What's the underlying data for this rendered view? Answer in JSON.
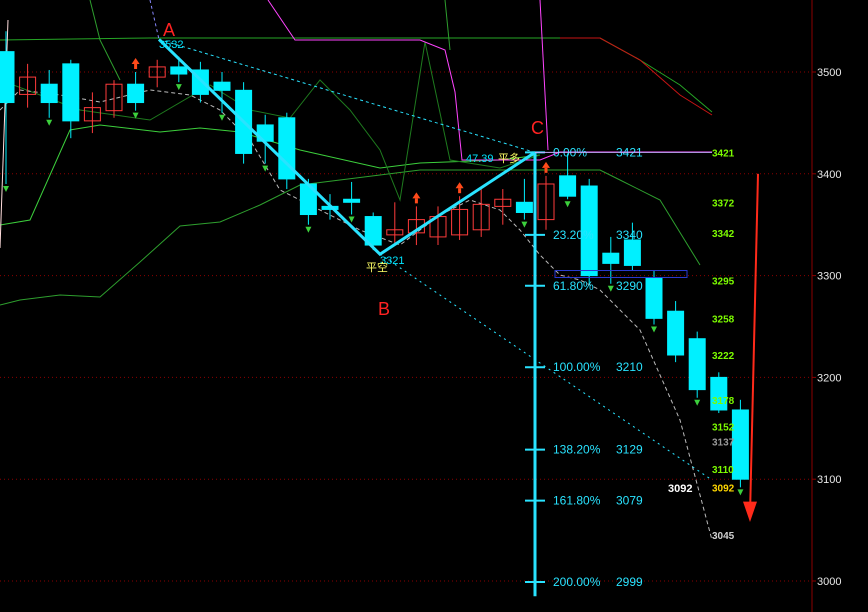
{
  "chart_data": {
    "type": "candlestick",
    "ylim": [
      2985,
      3600
    ],
    "grid": true,
    "price_axis": {
      "ticks": [
        3500,
        3400,
        3300,
        3200,
        3100,
        3000
      ]
    },
    "right_levels": [
      {
        "value": 3421,
        "color": "#7CFC00"
      },
      {
        "value": 3372,
        "color": "#7CFC00"
      },
      {
        "value": 3342,
        "color": "#7CFC00"
      },
      {
        "value": 3295,
        "color": "#7CFC00"
      },
      {
        "value": 3258,
        "color": "#7CFC00"
      },
      {
        "value": 3222,
        "color": "#7CFC00"
      },
      {
        "value": 3178,
        "color": "#7CFC00"
      },
      {
        "value": 3152,
        "color": "#7CFC00"
      },
      {
        "value": 3137,
        "color": "#9a9a9a"
      },
      {
        "value": 3110,
        "color": "#7CFC00"
      },
      {
        "value": 3092,
        "color": "#FFD700"
      },
      {
        "value": 3045,
        "color": "#d0d0d0"
      }
    ],
    "fib_levels": [
      {
        "pct": "0.00%",
        "price": "3421"
      },
      {
        "pct": "23.20%",
        "price": "3340"
      },
      {
        "pct": "61.80%",
        "price": "3290"
      },
      {
        "pct": "100.00%",
        "price": "3210"
      },
      {
        "pct": "138.20%",
        "price": "3129"
      },
      {
        "pct": "161.80%",
        "price": "3079"
      },
      {
        "pct": "200.00%",
        "price": "2999"
      }
    ],
    "fib_tick_values": [
      3421,
      3340,
      3290,
      3210,
      3129,
      3079,
      2999
    ],
    "points": [
      {
        "label": "A",
        "value": 3532,
        "value_label": "3532"
      },
      {
        "label": "B",
        "value": 3321,
        "value_label": "3321"
      },
      {
        "label": "C",
        "value": 3421,
        "value_label": ""
      }
    ],
    "annotations": {
      "ratio": "47.39",
      "b_tag": "平空",
      "c_tag": "平多",
      "low_label": "3092"
    },
    "candles": [
      {
        "o": 3520,
        "h": 3540,
        "l": 3390,
        "c": 3470
      },
      {
        "o": 3478,
        "h": 3508,
        "l": 3465,
        "c": 3495
      },
      {
        "o": 3488,
        "h": 3502,
        "l": 3455,
        "c": 3470
      },
      {
        "o": 3508,
        "h": 3512,
        "l": 3435,
        "c": 3452
      },
      {
        "o": 3452,
        "h": 3480,
        "l": 3440,
        "c": 3465
      },
      {
        "o": 3462,
        "h": 3492,
        "l": 3455,
        "c": 3488
      },
      {
        "o": 3488,
        "h": 3500,
        "l": 3462,
        "c": 3470
      },
      {
        "o": 3495,
        "h": 3512,
        "l": 3485,
        "c": 3505
      },
      {
        "o": 3505,
        "h": 3515,
        "l": 3490,
        "c": 3498
      },
      {
        "o": 3502,
        "h": 3510,
        "l": 3470,
        "c": 3478
      },
      {
        "o": 3490,
        "h": 3500,
        "l": 3460,
        "c": 3482
      },
      {
        "o": 3482,
        "h": 3490,
        "l": 3410,
        "c": 3420
      },
      {
        "o": 3448,
        "h": 3458,
        "l": 3410,
        "c": 3432
      },
      {
        "o": 3455,
        "h": 3460,
        "l": 3385,
        "c": 3395
      },
      {
        "o": 3390,
        "h": 3395,
        "l": 3350,
        "c": 3360
      },
      {
        "o": 3368,
        "h": 3380,
        "l": 3355,
        "c": 3365
      },
      {
        "o": 3375,
        "h": 3392,
        "l": 3360,
        "c": 3372
      },
      {
        "o": 3358,
        "h": 3362,
        "l": 3325,
        "c": 3330
      },
      {
        "o": 3340,
        "h": 3372,
        "l": 3332,
        "c": 3345
      },
      {
        "o": 3342,
        "h": 3368,
        "l": 3330,
        "c": 3355
      },
      {
        "o": 3338,
        "h": 3368,
        "l": 3330,
        "c": 3358
      },
      {
        "o": 3340,
        "h": 3378,
        "l": 3335,
        "c": 3365
      },
      {
        "o": 3345,
        "h": 3385,
        "l": 3338,
        "c": 3370
      },
      {
        "o": 3368,
        "h": 3385,
        "l": 3350,
        "c": 3375
      },
      {
        "o": 3372,
        "h": 3395,
        "l": 3355,
        "c": 3362
      },
      {
        "o": 3355,
        "h": 3398,
        "l": 3345,
        "c": 3390
      },
      {
        "o": 3398,
        "h": 3420,
        "l": 3375,
        "c": 3378
      },
      {
        "o": 3388,
        "h": 3395,
        "l": 3292,
        "c": 3300
      },
      {
        "o": 3322,
        "h": 3338,
        "l": 3292,
        "c": 3312
      },
      {
        "o": 3335,
        "h": 3352,
        "l": 3305,
        "c": 3310
      },
      {
        "o": 3298,
        "h": 3305,
        "l": 3252,
        "c": 3258
      },
      {
        "o": 3265,
        "h": 3275,
        "l": 3215,
        "c": 3222
      },
      {
        "o": 3238,
        "h": 3245,
        "l": 3180,
        "c": 3188
      },
      {
        "o": 3200,
        "h": 3205,
        "l": 3165,
        "c": 3168
      },
      {
        "o": 3168,
        "h": 3178,
        "l": 3092,
        "c": 3100
      }
    ]
  }
}
